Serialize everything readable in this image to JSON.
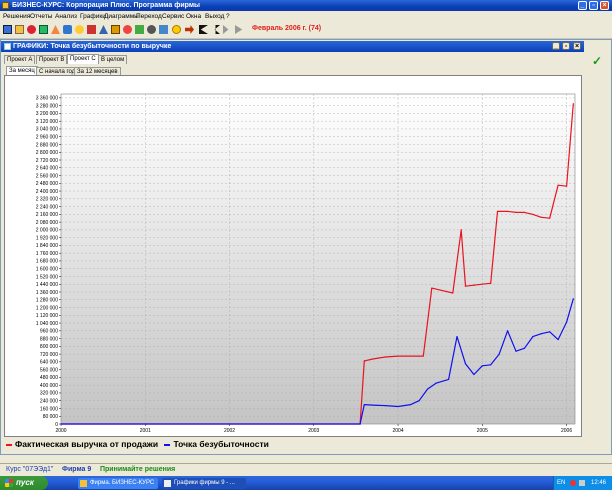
{
  "app": {
    "title": "БИЗНЕС-КУРС: Корпорация Плюс. Программа фирмы"
  },
  "menu": [
    "Решения",
    "Отчеты",
    "Анализ",
    "Графики",
    "Диаграммы",
    "Переход",
    "Сервис",
    "Окна",
    "Выход",
    "?"
  ],
  "toolbar": {
    "period": "Февраль 2006 г. (74)"
  },
  "window": {
    "title": "ГРАФИКИ: Точка безубыточности по выручке"
  },
  "tabs_projects": [
    "Проект А",
    "Проект В",
    "Проект С",
    "В целом"
  ],
  "tabs_range": [
    "За месяц",
    "С начала года",
    "За 12 месяцев"
  ],
  "legend": {
    "items": [
      "Фактическая выручка от продажи",
      "Точка безубыточности"
    ]
  },
  "colors": {
    "revenue": "#e8141e",
    "breakeven": "#1010f0",
    "accent_period": "#e0201c"
  },
  "chart_data": {
    "type": "line",
    "x_ticks": [
      "2000",
      "2001",
      "2002",
      "2003",
      "2004",
      "2005",
      "2006"
    ],
    "y_ticks": [
      "0",
      "80 000",
      "160 000",
      "240 000",
      "320 000",
      "400 000",
      "480 000",
      "560 000",
      "640 000",
      "720 000",
      "800 000",
      "880 000",
      "960 000",
      "1 040 000",
      "1 120 000",
      "1 200 000",
      "1 280 000",
      "1 360 000",
      "1 440 000",
      "1 520 000",
      "1 600 000",
      "1 680 000",
      "1 760 000",
      "1 840 000",
      "1 920 000",
      "2 000 000",
      "2 080 000",
      "2 160 000",
      "2 240 000",
      "2 320 000",
      "2 400 000",
      "2 480 000",
      "2 560 000",
      "2 640 000",
      "2 720 000",
      "2 800 000",
      "2 880 000",
      "2 960 000",
      "3 040 000",
      "3 120 000",
      "3 200 000",
      "3 280 000",
      "3 360 000"
    ],
    "xlim": [
      2000,
      2006.1
    ],
    "ylim": [
      0,
      3400000
    ],
    "grid": true,
    "legend_position": "bottom-left",
    "series": [
      {
        "name": "Фактическая выручка от продажи",
        "color": "#e8141e",
        "x": [
          2000,
          2003.55,
          2003.6,
          2003.7,
          2003.85,
          2004.0,
          2004.15,
          2004.3,
          2004.4,
          2004.5,
          2004.65,
          2004.75,
          2004.8,
          2004.9,
          2005.0,
          2005.1,
          2005.18,
          2005.3,
          2005.4,
          2005.5,
          2005.6,
          2005.7,
          2005.8,
          2005.9,
          2006.0,
          2006.08
        ],
        "y": [
          0,
          0,
          650000,
          670000,
          690000,
          700000,
          700000,
          700000,
          1400000,
          1380000,
          1350000,
          2000000,
          1420000,
          1430000,
          1440000,
          1450000,
          2190000,
          2190000,
          2180000,
          2180000,
          2160000,
          2130000,
          2120000,
          2460000,
          2450000,
          3300000
        ]
      },
      {
        "name": "Точка безубыточности",
        "color": "#1010f0",
        "x": [
          2000,
          2003.55,
          2003.6,
          2003.7,
          2003.85,
          2004.0,
          2004.15,
          2004.25,
          2004.35,
          2004.45,
          2004.6,
          2004.7,
          2004.8,
          2004.9,
          2005.0,
          2005.1,
          2005.2,
          2005.3,
          2005.4,
          2005.5,
          2005.6,
          2005.7,
          2005.8,
          2005.9,
          2006.0,
          2006.08
        ],
        "y": [
          0,
          0,
          200000,
          195000,
          190000,
          180000,
          200000,
          240000,
          360000,
          420000,
          460000,
          900000,
          620000,
          510000,
          600000,
          610000,
          720000,
          960000,
          750000,
          780000,
          900000,
          930000,
          950000,
          870000,
          1050000,
          1290000
        ]
      }
    ]
  },
  "status": {
    "course": "Курс \"07ЭЭд1\"",
    "firm": "Фирма 9",
    "decision": "Принимайте решения"
  },
  "taskbar": {
    "start": "пуск",
    "tasks": [
      "Фирма. БИЗНЕС-КУРС",
      "Графики фирмы 9 - ..."
    ],
    "lang": "EN",
    "clock": "12:46"
  }
}
